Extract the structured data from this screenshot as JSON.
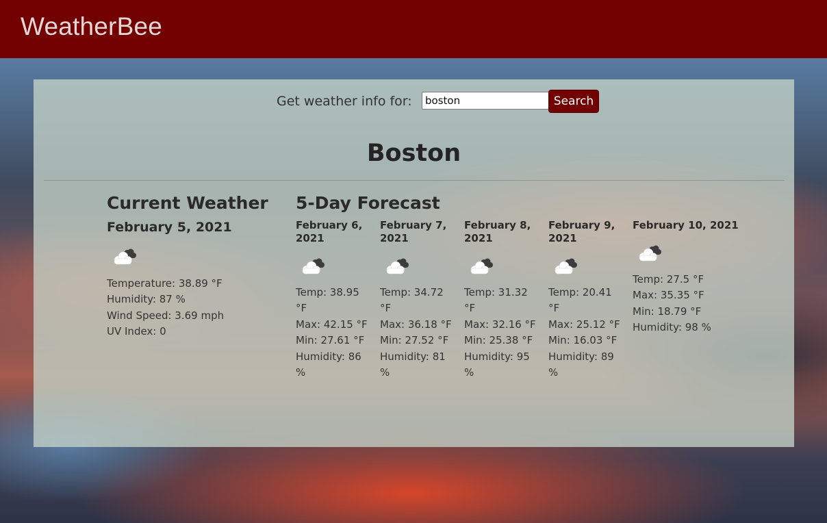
{
  "header": {
    "brand": "WeatherBee"
  },
  "search": {
    "label": "Get weather info for:",
    "value": "boston",
    "button_label": "Search"
  },
  "city": "Boston",
  "current": {
    "heading": "Current Weather",
    "date": "February 5, 2021",
    "icon": "cloudy-icon",
    "stats": [
      "Temperature: 38.89 °F",
      "Humidity: 87 %",
      "Wind Speed: 3.69 mph",
      "UV Index: 0"
    ]
  },
  "forecast": {
    "heading": "5-Day Forecast",
    "days": [
      {
        "date_line1": "February 6,",
        "date_line2": "2021",
        "lines": [
          "Temp: 38.95",
          "°F",
          "Max: 42.15 °F",
          "Min: 27.61 °F",
          "Humidity: 86",
          "%"
        ]
      },
      {
        "date_line1": "February 7,",
        "date_line2": "2021",
        "lines": [
          "Temp: 34.72",
          "°F",
          "Max: 36.18 °F",
          "Min: 27.52 °F",
          "Humidity: 81",
          "%"
        ]
      },
      {
        "date_line1": "February 8,",
        "date_line2": "2021",
        "lines": [
          "Temp: 31.32",
          "°F",
          "Max: 32.16 °F",
          "Min: 25.38 °F",
          "Humidity: 95",
          "%"
        ]
      },
      {
        "date_line1": "February 9,",
        "date_line2": "2021",
        "lines": [
          "Temp: 20.41",
          "°F",
          "Max: 25.12 °F",
          "Min: 16.03 °F",
          "Humidity: 89",
          "%"
        ]
      },
      {
        "date_line1": "February 10, 2021",
        "date_line2": "",
        "lines": [
          "Temp: 27.5 °F",
          "Max: 35.35 °F",
          "Min: 18.79 °F",
          "Humidity: 98 %"
        ]
      }
    ]
  },
  "colors": {
    "navbar": "#730000",
    "button": "#730000"
  }
}
